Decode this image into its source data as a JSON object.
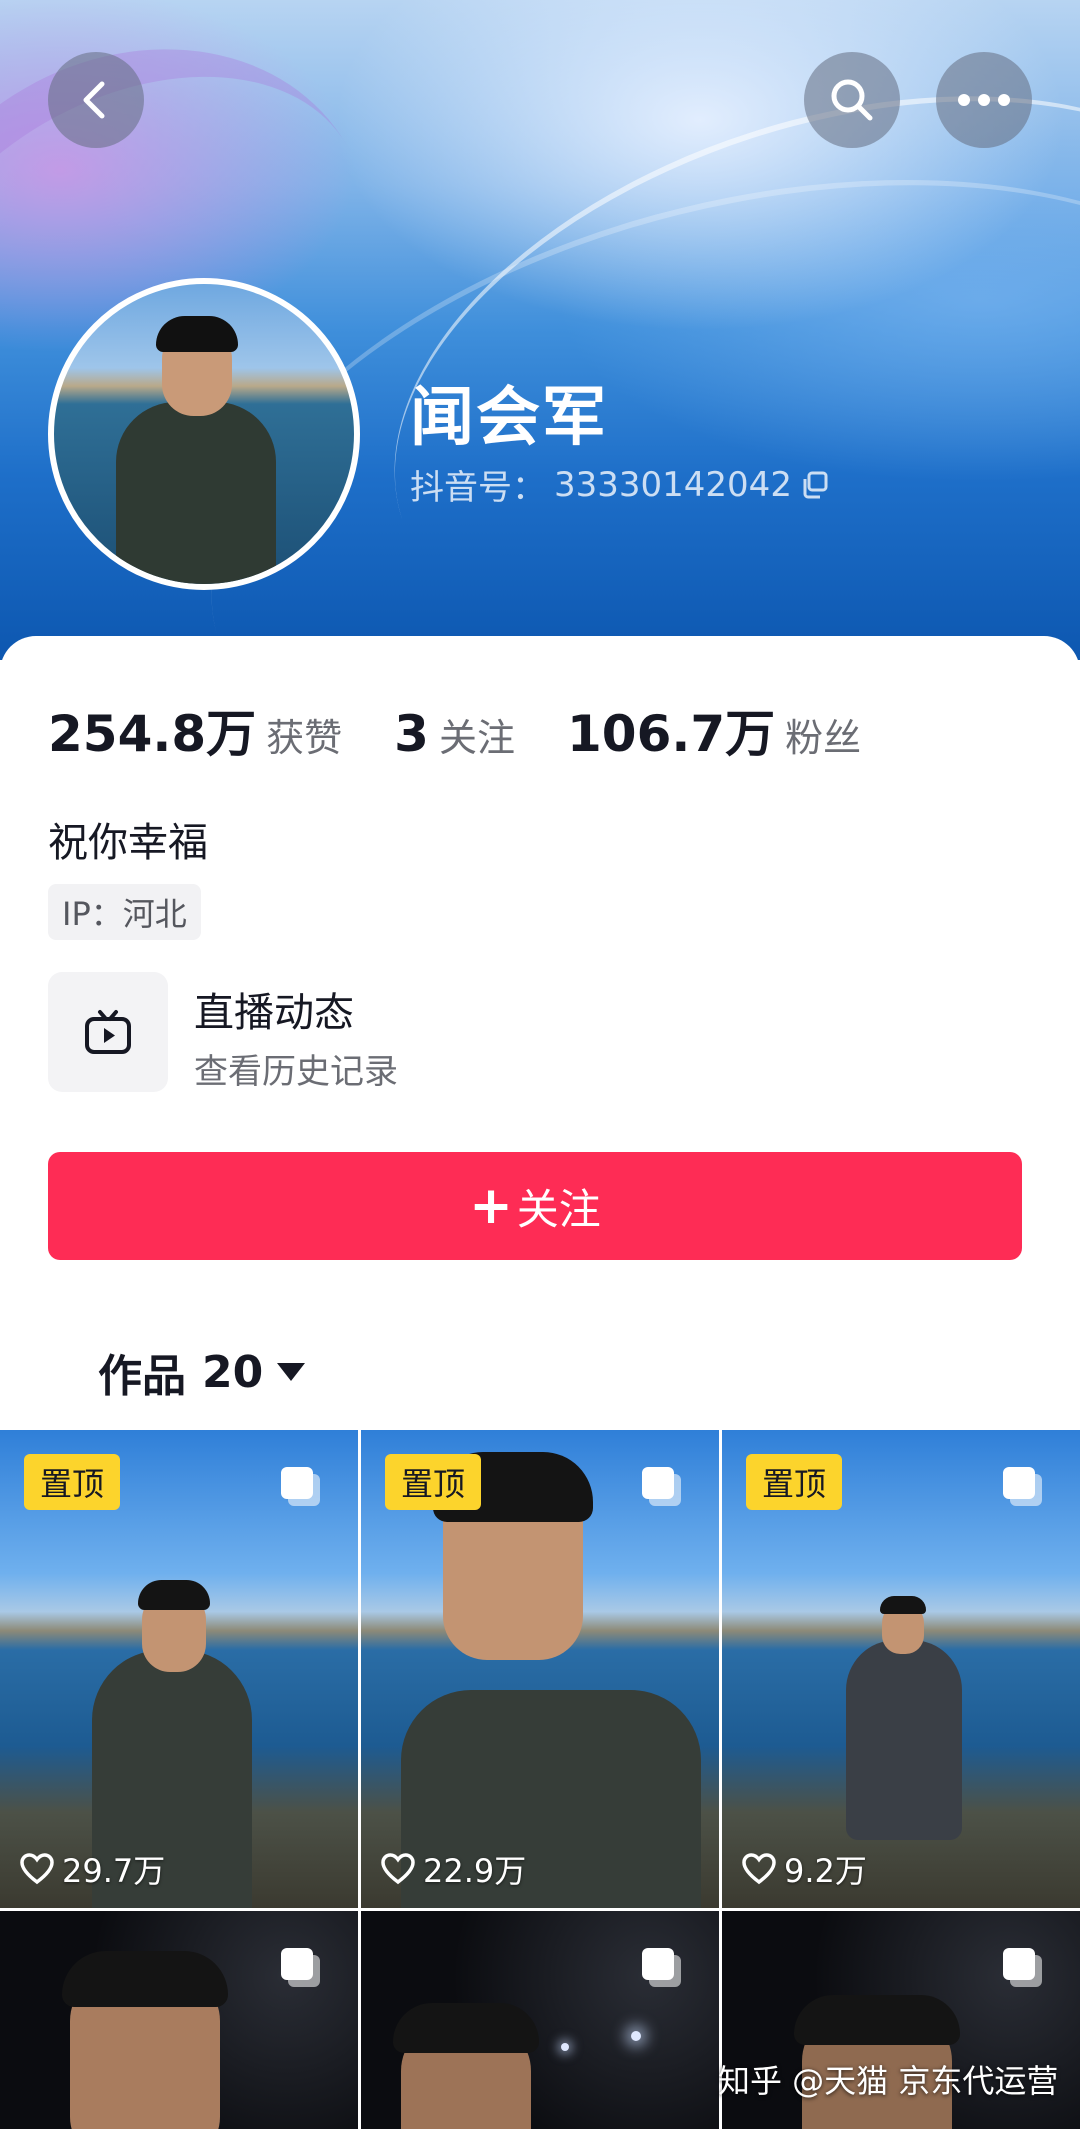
{
  "header": {
    "back_icon": "chevron-left-icon",
    "search_icon": "search-icon",
    "more_icon": "ellipsis-icon"
  },
  "profile": {
    "name": "闻会军",
    "douyin_id_label": "抖音号：",
    "douyin_id": "33330142042",
    "copy_icon": "copy-icon"
  },
  "stats": [
    {
      "value": "254.8万",
      "label": "获赞"
    },
    {
      "value": "3",
      "label": "关注"
    },
    {
      "value": "106.7万",
      "label": "粉丝"
    }
  ],
  "bio": "祝你幸福",
  "ip": "IP：河北",
  "live": {
    "icon": "tv-icon",
    "title": "直播动态",
    "subtitle": "查看历史记录"
  },
  "follow_button": {
    "plus": "+",
    "label": "关注",
    "color": "#fe2c55"
  },
  "works_tab": {
    "label": "作品",
    "count": "20"
  },
  "videos": [
    {
      "pinned": true,
      "pin_label": "置顶",
      "likes": "29.7万"
    },
    {
      "pinned": true,
      "pin_label": "置顶",
      "likes": "22.9万"
    },
    {
      "pinned": true,
      "pin_label": "置顶",
      "likes": "9.2万"
    },
    {
      "pinned": false,
      "likes": ""
    },
    {
      "pinned": false,
      "likes": ""
    },
    {
      "pinned": false,
      "likes": ""
    }
  ],
  "watermark": "知乎 @天猫 京东代运营"
}
